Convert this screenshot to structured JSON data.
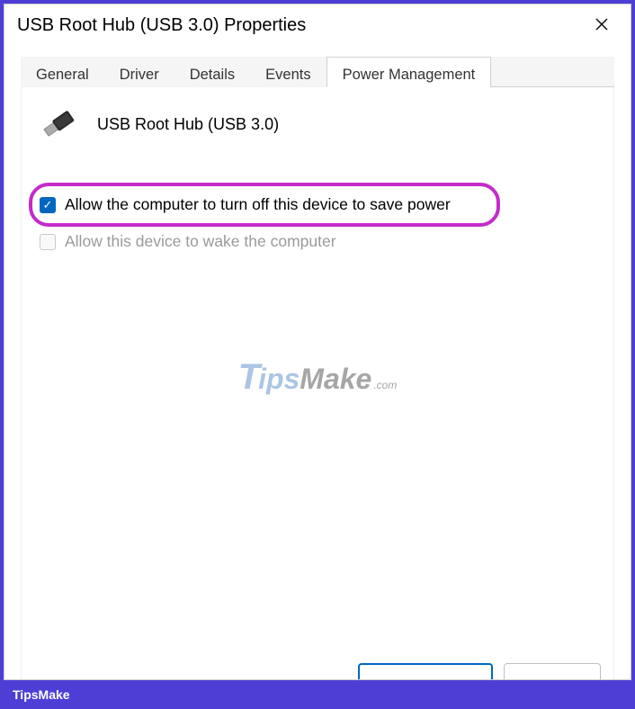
{
  "window": {
    "title": "USB Root Hub (USB 3.0) Properties"
  },
  "tabs": {
    "general": "General",
    "driver": "Driver",
    "details": "Details",
    "events": "Events",
    "power_management": "Power Management"
  },
  "device": {
    "name": "USB Root Hub (USB 3.0)"
  },
  "options": {
    "allow_turnoff": {
      "label": "Allow the computer to turn off this device to save power",
      "checked": true
    },
    "allow_wake": {
      "label": "Allow this device to wake the computer",
      "checked": false,
      "disabled": true
    }
  },
  "watermark": {
    "t": "T",
    "ips": "ips",
    "make": "Make",
    "com": ".com"
  },
  "footer": {
    "brand": "TipsMake"
  }
}
